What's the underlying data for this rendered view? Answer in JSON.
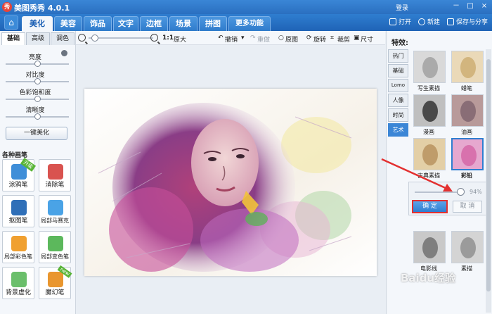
{
  "app": {
    "title": "美图秀秀 4.0.1",
    "logo_text": "秀",
    "login": "登录"
  },
  "window_controls": [
    "－",
    "□",
    "×"
  ],
  "main_tabs": [
    "美化",
    "美容",
    "饰品",
    "文字",
    "边框",
    "场景",
    "拼图",
    "更多功能 ▾"
  ],
  "header_actions": {
    "open": "打开",
    "new": "新建",
    "save": "保存与分享"
  },
  "toolbar": {
    "ratio": "1:1",
    "original_size": "原大",
    "undo": "撤销",
    "redo": "重做",
    "original": "原图",
    "rotate": "旋转",
    "crop": "裁剪",
    "size": "尺寸"
  },
  "left_panel": {
    "subtabs": [
      "基础",
      "高级",
      "调色"
    ],
    "sliders": [
      "亮度",
      "对比度",
      "色彩饱和度",
      "清晰度"
    ],
    "one_key_button": "一键美化",
    "brush_title": "各种画笔",
    "brushes": [
      {
        "label": "涂鸦笔",
        "badge": "升级",
        "color": "#3f8ed8"
      },
      {
        "label": "消除笔",
        "badge": "",
        "color": "#d9534f"
      },
      {
        "label": "抠图笔",
        "badge": "",
        "color": "#2f6fb8"
      },
      {
        "label": "局部马赛克",
        "badge": "",
        "color": "#4aa3e6"
      },
      {
        "label": "局部彩色笔",
        "badge": "",
        "color": "#f0a030"
      },
      {
        "label": "局部变色笔",
        "badge": "",
        "color": "#5cb85c"
      },
      {
        "label": "背景虚化",
        "badge": "",
        "color": "#6bbf6b"
      },
      {
        "label": "魔幻笔",
        "badge": "new",
        "color": "#e9962e"
      }
    ]
  },
  "right_panel": {
    "title": "特效:",
    "categories": [
      "热门",
      "基础",
      "Lomo",
      "人像",
      "时尚",
      "艺术"
    ],
    "active_category": "艺术",
    "thumbs": [
      {
        "label": "写生素描",
        "selected": false,
        "tint": "#9a9a9a"
      },
      {
        "label": "蜡笔",
        "selected": false,
        "tint": "#c9a86b"
      },
      {
        "label": "漫画",
        "selected": false,
        "tint": "#222222"
      },
      {
        "label": "油画",
        "selected": false,
        "tint": "#7a5e6a"
      },
      {
        "label": "古典素描",
        "selected": false,
        "tint": "#b38b55"
      },
      {
        "label": "彩铅",
        "selected": true,
        "tint": "#d35fa1"
      },
      {
        "label": "电影线",
        "selected": false,
        "tint": "#666666"
      },
      {
        "label": "素描",
        "selected": false,
        "tint": "#888888"
      }
    ],
    "strength": {
      "value": 0.94,
      "text": "94%"
    },
    "ok_button": "确 定",
    "cancel_button": "取 消"
  },
  "watermark": "Baidu经验",
  "colors": {
    "accent": "#2f7ed0",
    "highlight": "#e33030"
  }
}
